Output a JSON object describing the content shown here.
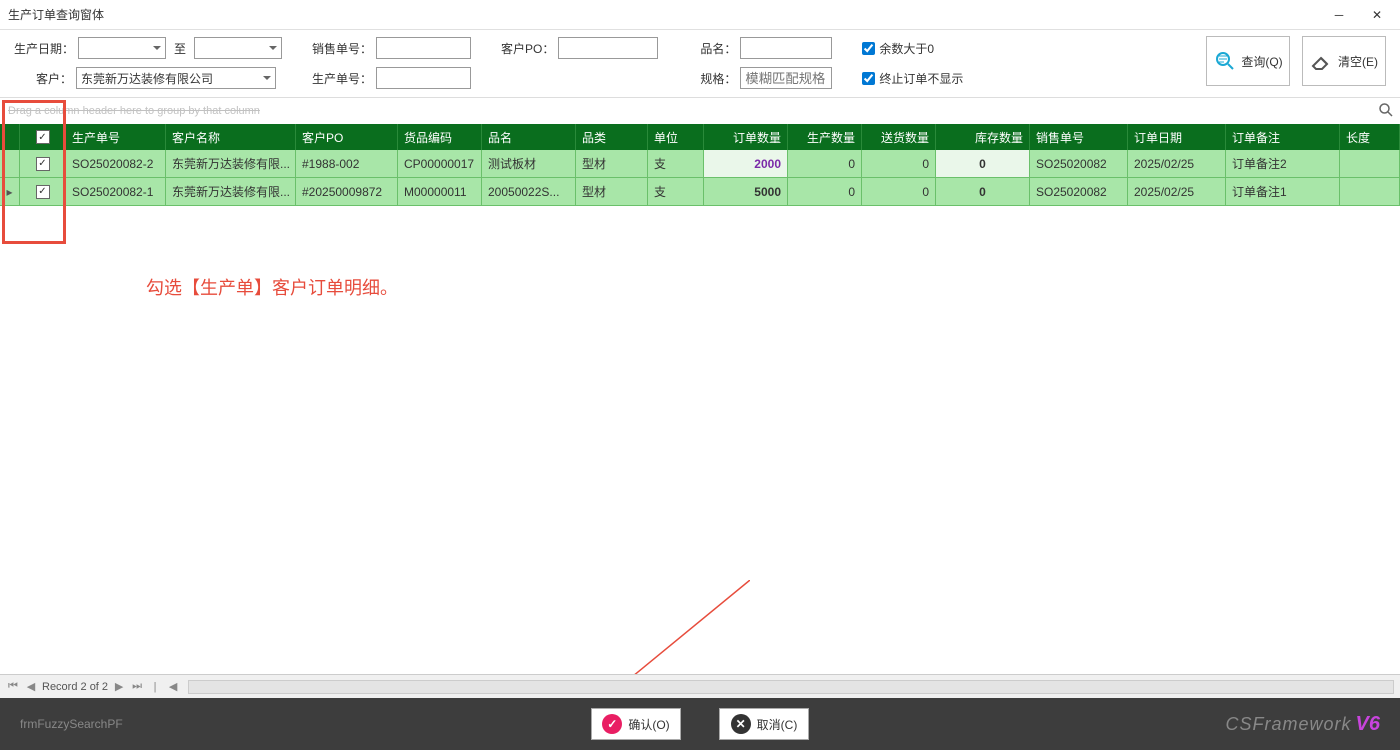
{
  "window": {
    "title": "生产订单查询窗体"
  },
  "filters": {
    "prod_date_label": "生产日期：",
    "to_label": "至",
    "customer_label": "客户：",
    "customer_value": "东莞新万达装修有限公司",
    "sales_no_label": "销售单号：",
    "prod_no_label": "生产单号：",
    "cust_po_label": "客户PO：",
    "name_label": "品名：",
    "spec_label": "规格：",
    "spec_placeholder": "模糊匹配规格",
    "remain_gt0": "余数大于0",
    "hide_closed": "终止订单不显示",
    "query_btn": "查询(Q)",
    "clear_btn": "清空(E)"
  },
  "group_hint": "Drag a column header here to group by that column",
  "columns": {
    "prod": "生产单号",
    "cust": "客户名称",
    "po": "客户PO",
    "code": "货品编码",
    "name": "品名",
    "cat": "品类",
    "unit": "单位",
    "oqty": "订单数量",
    "pqty": "生产数量",
    "sqty": "送货数量",
    "stock": "库存数量",
    "sales": "销售单号",
    "date": "订单日期",
    "remark": "订单备注",
    "len": "长度"
  },
  "rows": [
    {
      "prod": "SO25020082-2",
      "cust": "东莞新万达装修有限...",
      "po": "#1988-002",
      "code": "CP00000017",
      "name": "测试板材",
      "cat": "型材",
      "unit": "支",
      "oqty": "2000",
      "pqty": "0",
      "sqty": "0",
      "stock": "0",
      "sales": "SO25020082",
      "date": "2025/02/25",
      "remark": "订单备注2",
      "hl": true
    },
    {
      "prod": "SO25020082-1",
      "cust": "东莞新万达装修有限...",
      "po": "#20250009872",
      "code": "M00000011",
      "name": "20050022S...",
      "cat": "型材",
      "unit": "支",
      "oqty": "5000",
      "pqty": "0",
      "sqty": "0",
      "stock": "0",
      "sales": "SO25020082",
      "date": "2025/02/25",
      "remark": "订单备注1",
      "hl": false,
      "current": true
    }
  ],
  "annotation": "勾选【生产单】客户订单明细。",
  "pager": {
    "record_text": "Record 2 of 2"
  },
  "footer": {
    "form_name": "frmFuzzySearchPF",
    "ok": "确认(O)",
    "cancel": "取消(C)",
    "brand_cs": "CSFramework",
    "brand_v": "V6"
  }
}
